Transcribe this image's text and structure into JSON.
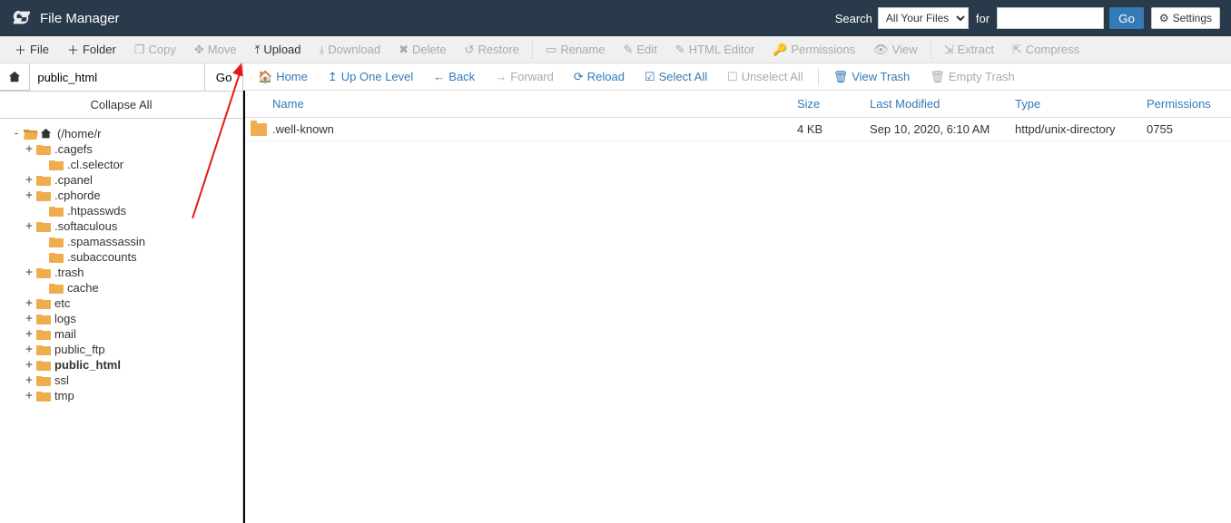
{
  "header": {
    "title": "File Manager",
    "search_label": "Search",
    "search_select": "All Your Files",
    "for_label": "for",
    "search_value": "",
    "go": "Go",
    "settings": "Settings"
  },
  "toolbar1": {
    "file": "File",
    "folder": "Folder",
    "copy": "Copy",
    "move": "Move",
    "upload": "Upload",
    "download": "Download",
    "delete": "Delete",
    "restore": "Restore",
    "rename": "Rename",
    "edit": "Edit",
    "html_editor": "HTML Editor",
    "permissions": "Permissions",
    "view": "View",
    "extract": "Extract",
    "compress": "Compress"
  },
  "path": {
    "value": "public_html",
    "go": "Go"
  },
  "collapse_all": "Collapse All",
  "tree": [
    {
      "label": "(/home/r",
      "level": 0,
      "toggle": "-",
      "open": true,
      "home": true
    },
    {
      "label": ".cagefs",
      "level": 1,
      "toggle": "+",
      "open": false
    },
    {
      "label": ".cl.selector",
      "level": 2,
      "toggle": "",
      "open": false
    },
    {
      "label": ".cpanel",
      "level": 1,
      "toggle": "+",
      "open": false
    },
    {
      "label": ".cphorde",
      "level": 1,
      "toggle": "+",
      "open": false
    },
    {
      "label": ".htpasswds",
      "level": 2,
      "toggle": "",
      "open": false
    },
    {
      "label": ".softaculous",
      "level": 1,
      "toggle": "+",
      "open": false
    },
    {
      "label": ".spamassassin",
      "level": 2,
      "toggle": "",
      "open": false
    },
    {
      "label": ".subaccounts",
      "level": 2,
      "toggle": "",
      "open": false
    },
    {
      "label": ".trash",
      "level": 1,
      "toggle": "+",
      "open": false
    },
    {
      "label": "cache",
      "level": 2,
      "toggle": "",
      "open": false
    },
    {
      "label": "etc",
      "level": 1,
      "toggle": "+",
      "open": false
    },
    {
      "label": "logs",
      "level": 1,
      "toggle": "+",
      "open": false
    },
    {
      "label": "mail",
      "level": 1,
      "toggle": "+",
      "open": false
    },
    {
      "label": "public_ftp",
      "level": 1,
      "toggle": "+",
      "open": false
    },
    {
      "label": "public_html",
      "level": 1,
      "toggle": "+",
      "open": false,
      "bold": true
    },
    {
      "label": "ssl",
      "level": 1,
      "toggle": "+",
      "open": false
    },
    {
      "label": "tmp",
      "level": 1,
      "toggle": "+",
      "open": false
    }
  ],
  "toolbar2": {
    "home": "Home",
    "up": "Up One Level",
    "back": "Back",
    "forward": "Forward",
    "reload": "Reload",
    "select_all": "Select All",
    "unselect_all": "Unselect All",
    "view_trash": "View Trash",
    "empty_trash": "Empty Trash"
  },
  "columns": {
    "name": "Name",
    "size": "Size",
    "last_modified": "Last Modified",
    "type": "Type",
    "permissions": "Permissions"
  },
  "rows": [
    {
      "name": ".well-known",
      "size": "4 KB",
      "modified": "Sep 10, 2020, 6:10 AM",
      "type": "httpd/unix-directory",
      "perm": "0755"
    }
  ]
}
